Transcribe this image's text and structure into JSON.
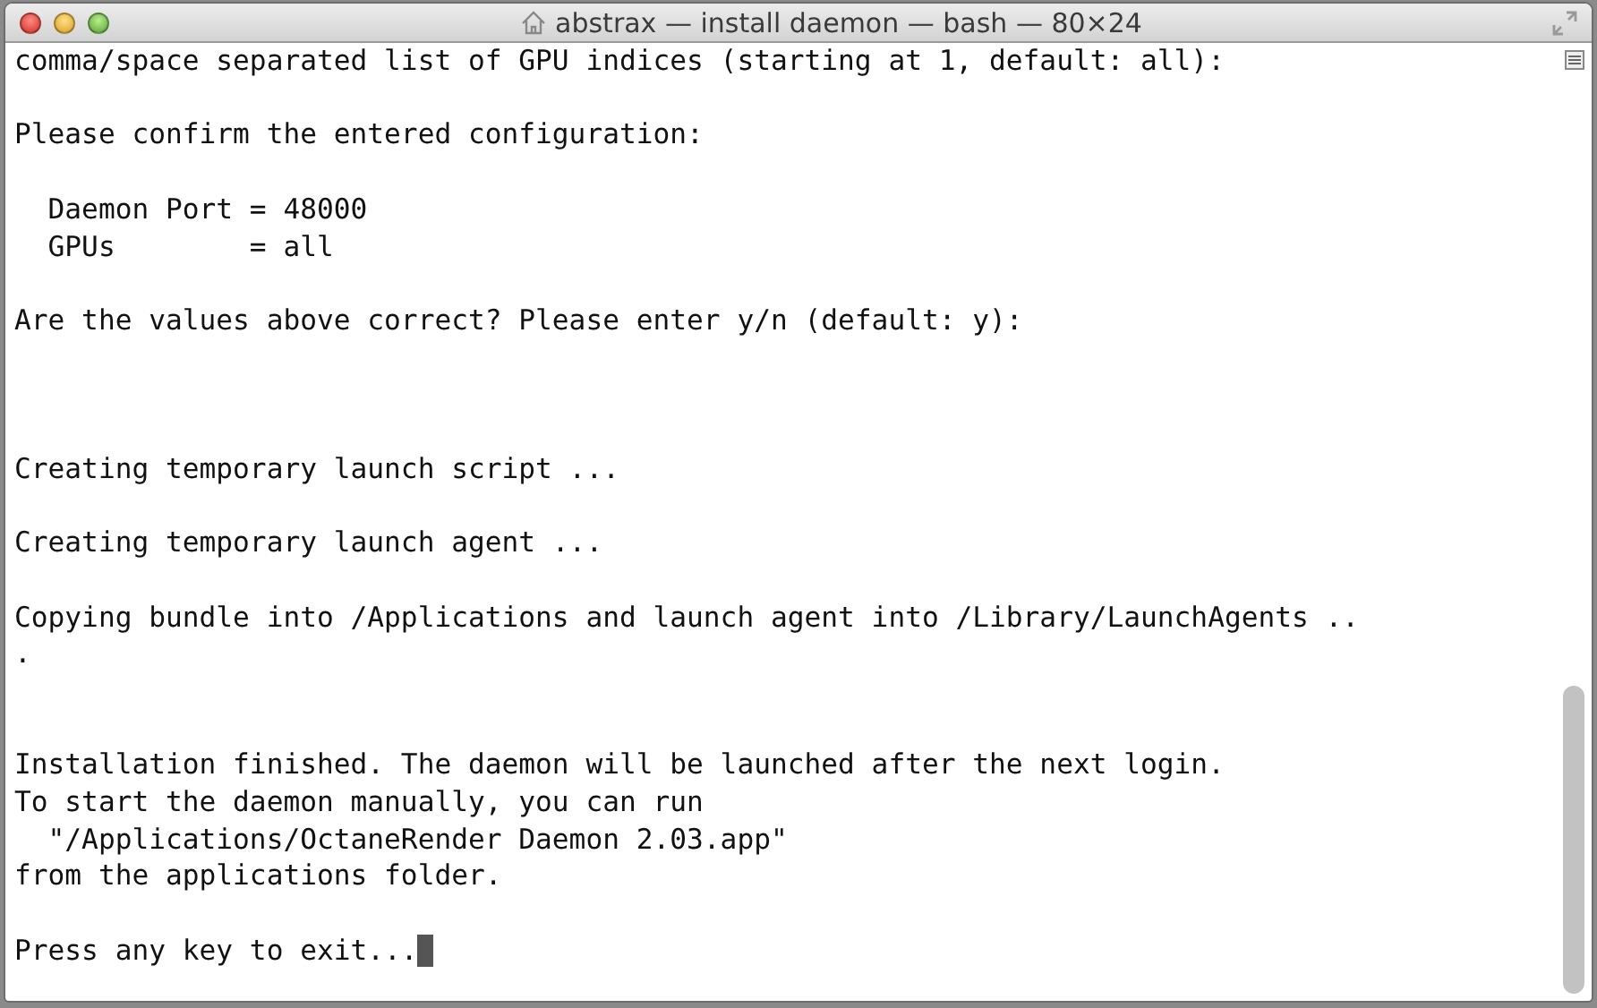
{
  "window": {
    "title": "abstrax — install daemon — bash — 80×24"
  },
  "terminal": {
    "output": "comma/space separated list of GPU indices (starting at 1, default: all):\n\nPlease confirm the entered configuration:\n\n  Daemon Port = 48000\n  GPUs        = all\n\nAre the values above correct? Please enter y/n (default: y):\n\n\n\nCreating temporary launch script ...\n\nCreating temporary launch agent ...\n\nCopying bundle into /Applications and launch agent into /Library/LaunchAgents ..\n.\n\n\nInstallation finished. The daemon will be launched after the next login.\nTo start the daemon manually, you can run\n  \"/Applications/OctaneRender Daemon 2.03.app\"\nfrom the applications folder.\n\nPress any key to exit...",
    "cursor_visible": true
  }
}
